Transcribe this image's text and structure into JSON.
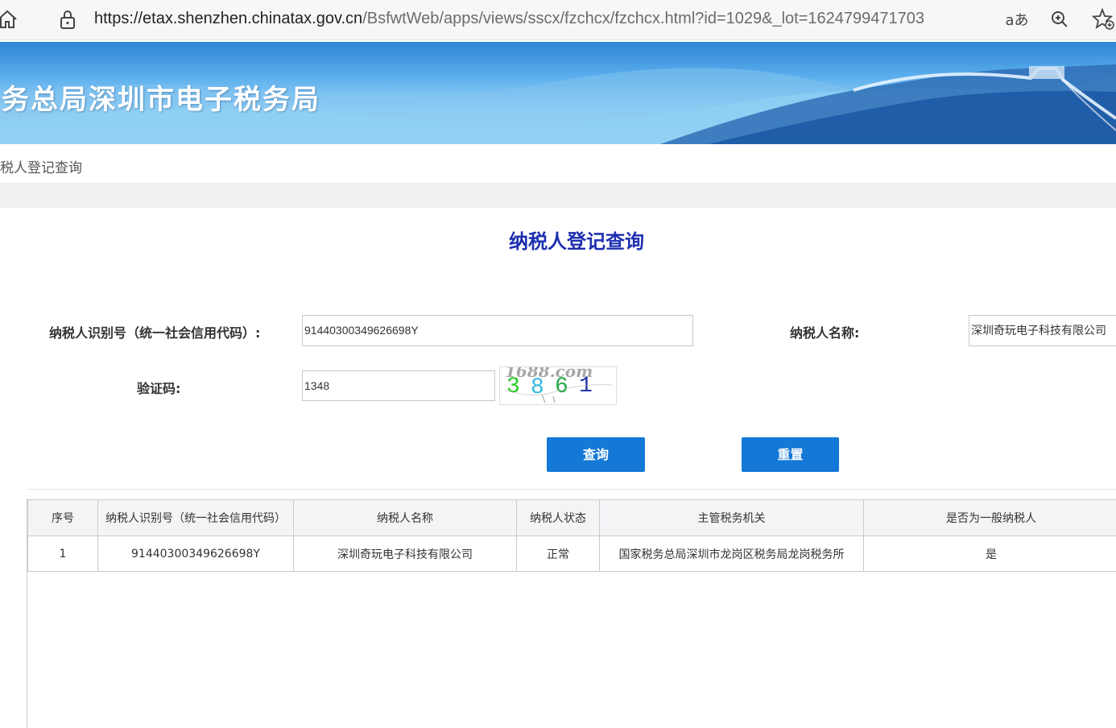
{
  "browser": {
    "url_host": "https://etax.shenzhen.chinatax.gov.cn",
    "url_path": "/BsfwtWeb/apps/views/sscx/fzchcx/fzchcx.html?id=1029&_lot=1624799471703",
    "read_aloud_glyph": "aあ"
  },
  "banner": {
    "title": "务总局深圳市电子税务局"
  },
  "breadcrumb": "税人登记查询",
  "form": {
    "title": "纳税人登记查询",
    "taxid_label": "纳税人识别号（统一社会信用代码）:",
    "taxid_value": "91440300349626698Y",
    "name_label": "纳税人名称:",
    "name_value": "深圳奇玩电子科技有限公司",
    "captcha_label": "验证码:",
    "captcha_value": "1348",
    "captcha_image_text": "3861",
    "captcha_watermark": "1688.com",
    "query_button": "查询",
    "reset_button": "重置"
  },
  "table": {
    "headers": [
      "序号",
      "纳税人识别号（统一社会信用代码）",
      "纳税人名称",
      "纳税人状态",
      "主管税务机关",
      "是否为一般纳税人"
    ],
    "rows": [
      [
        "1",
        "91440300349626698Y",
        "深圳奇玩电子科技有限公司",
        "正常",
        "国家税务总局深圳市龙岗区税务局龙岗税务所",
        "是"
      ]
    ]
  },
  "colors": {
    "title_blue": "#1d2fb0",
    "button_blue": "#1478d6",
    "captcha_digits": [
      "#22cc22",
      "#33bbdd",
      "#22aa44",
      "#2233aa"
    ]
  }
}
